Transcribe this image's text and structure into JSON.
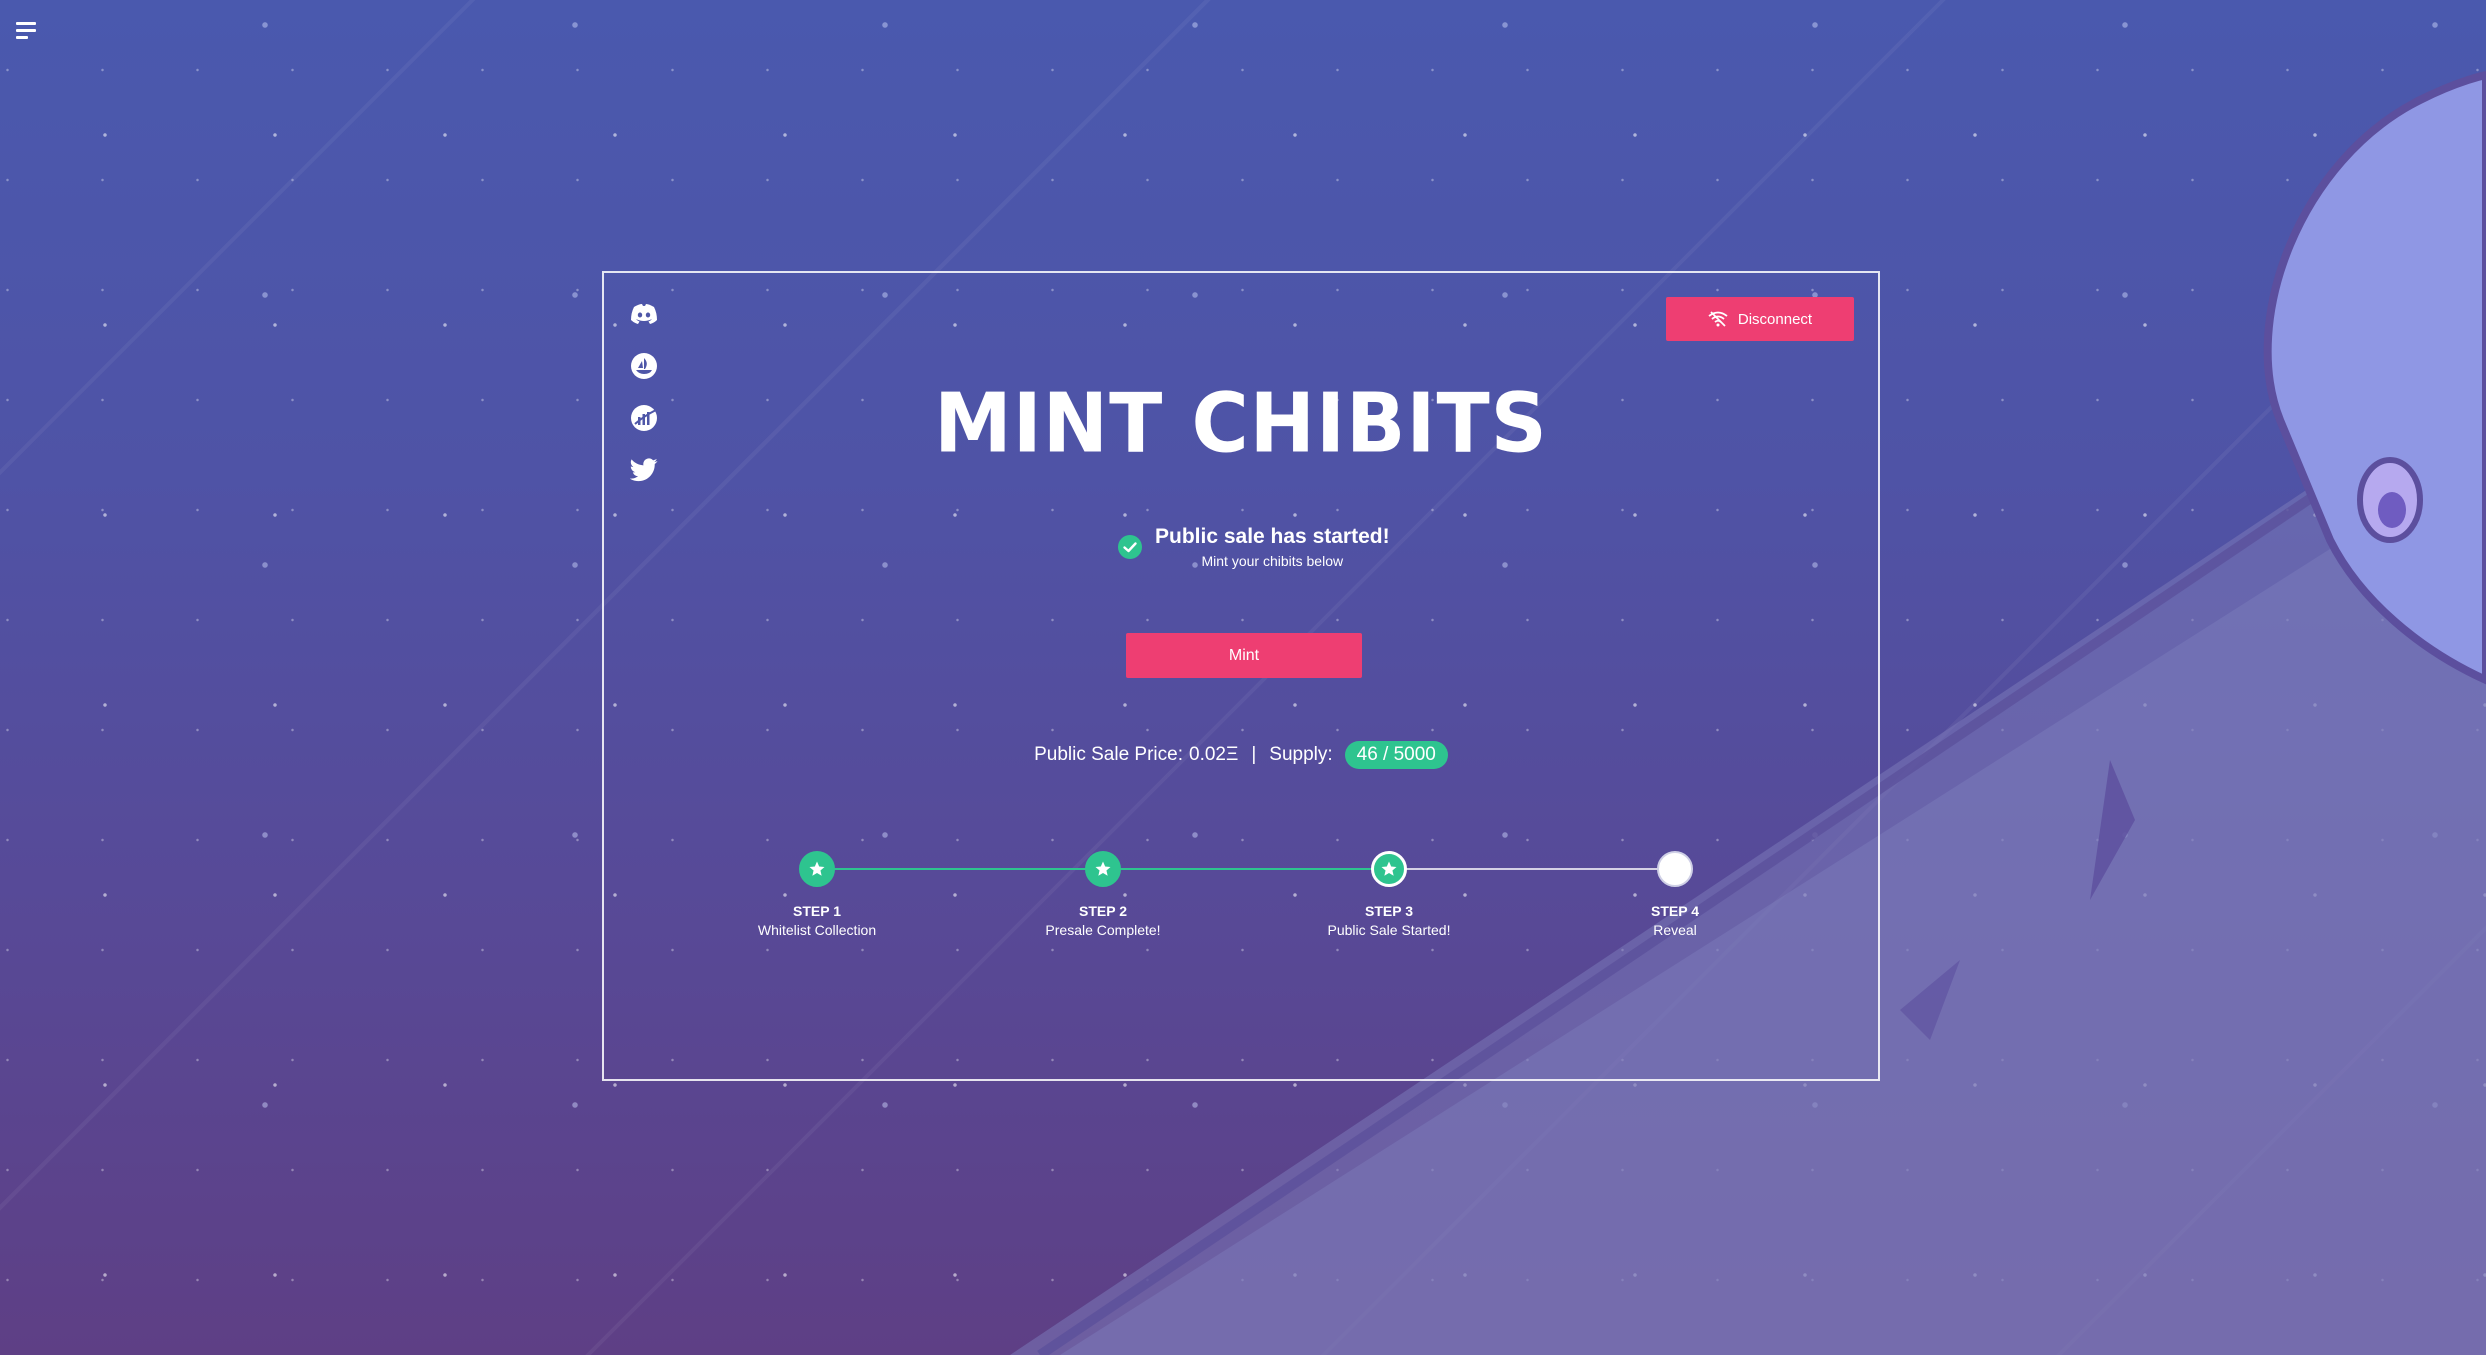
{
  "menu": {
    "icon": "hamburger-menu-icon"
  },
  "social_links": [
    {
      "name": "discord",
      "icon": "discord-icon"
    },
    {
      "name": "opensea",
      "icon": "opensea-icon"
    },
    {
      "name": "etherscan",
      "icon": "etherscan-icon"
    },
    {
      "name": "twitter",
      "icon": "twitter-icon"
    }
  ],
  "header": {
    "disconnect_label": "Disconnect",
    "disconnect_icon": "wifi-off-icon"
  },
  "main": {
    "title": "MINT CHIBITS",
    "status_title": "Public sale has started!",
    "status_subtitle": "Mint your chibits below",
    "mint_label": "Mint",
    "price_label": "Public Sale Price:",
    "price_value": "0.02Ξ",
    "separator": "|",
    "supply_label": "Supply:",
    "supply_value": "46 / 5000"
  },
  "steps": [
    {
      "num": "STEP 1",
      "desc": "Whitelist Collection",
      "state": "complete"
    },
    {
      "num": "STEP 2",
      "desc": "Presale Complete!",
      "state": "complete"
    },
    {
      "num": "STEP 3",
      "desc": "Public Sale Started!",
      "state": "current"
    },
    {
      "num": "STEP 4",
      "desc": "Reveal",
      "state": "pending"
    }
  ],
  "colors": {
    "accent": "#ee3e72",
    "success": "#2ec48f",
    "background_top": "#4a59ae",
    "background_bottom": "#5e3f85"
  }
}
